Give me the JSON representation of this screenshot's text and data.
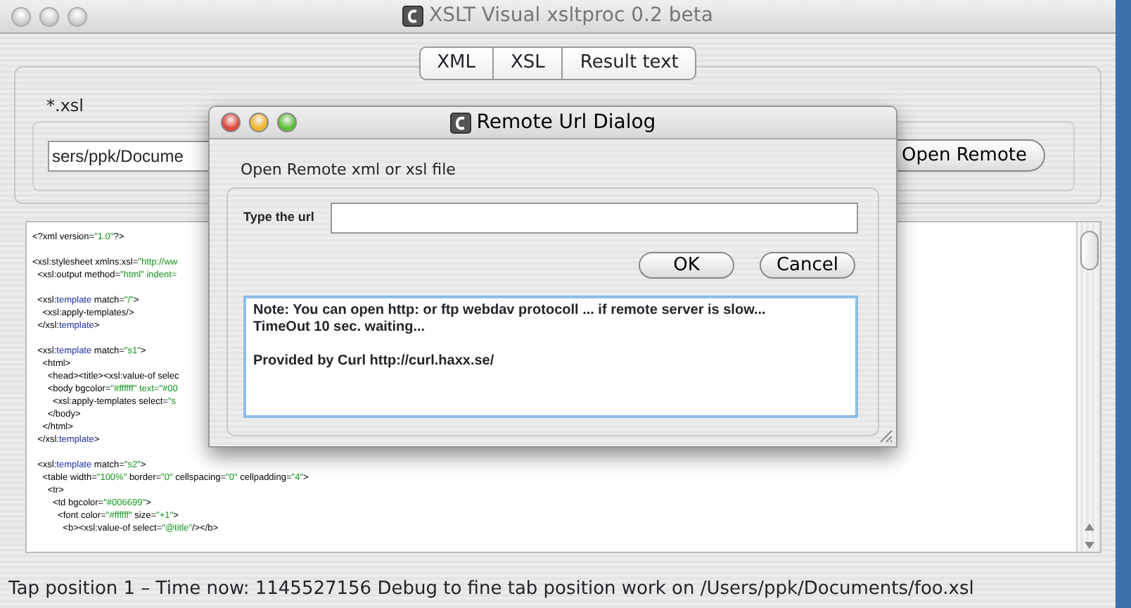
{
  "window": {
    "title": "XSLT Visual xsltproc 0.2 beta",
    "active": false
  },
  "tabs": [
    {
      "label": "XML",
      "selected": false
    },
    {
      "label": "XSL",
      "selected": false
    },
    {
      "label": "Result text",
      "selected": false
    }
  ],
  "file_label": "*.xsl",
  "path_field": {
    "value": "sers/ppk/Docume"
  },
  "open_remote_button": "Open Remote",
  "code_blocks": [
    [
      [
        {
          "kind": "tag",
          "text": "<?xml version="
        },
        {
          "kind": "value",
          "text": "\"1.0\""
        },
        {
          "kind": "tag",
          "text": "?>"
        }
      ]
    ],
    [
      [
        {
          "kind": "tag",
          "text": "<xsl:stylesheet xmlns:xsl="
        },
        {
          "kind": "value",
          "text": "\"http://ww"
        }
      ],
      [
        {
          "kind": "tag",
          "text": "  <xsl:output method="
        },
        {
          "kind": "value",
          "text": "\"html\" indent="
        }
      ]
    ],
    [
      [
        {
          "kind": "tag",
          "text": "  <xsl:"
        },
        {
          "kind": "keyword",
          "text": "template"
        },
        {
          "kind": "tag",
          "text": " match="
        },
        {
          "kind": "value",
          "text": "\"/\""
        },
        {
          "kind": "tag",
          "text": ">"
        }
      ],
      [
        {
          "kind": "tag",
          "text": "    <xsl:apply-templates/>"
        }
      ],
      [
        {
          "kind": "tag",
          "text": "  </xsl:"
        },
        {
          "kind": "keyword",
          "text": "template"
        },
        {
          "kind": "tag",
          "text": ">"
        }
      ]
    ],
    [
      [
        {
          "kind": "tag",
          "text": "  <xsl:"
        },
        {
          "kind": "keyword",
          "text": "template"
        },
        {
          "kind": "tag",
          "text": " match="
        },
        {
          "kind": "value",
          "text": "\"s1\""
        },
        {
          "kind": "tag",
          "text": ">"
        }
      ],
      [
        {
          "kind": "tag",
          "text": "    <html>"
        }
      ],
      [
        {
          "kind": "tag",
          "text": "      <head><title><xsl:value-of selec"
        }
      ],
      [
        {
          "kind": "tag",
          "text": "      <body bgcolor="
        },
        {
          "kind": "value",
          "text": "\"#ffffff\" text=\"#00"
        }
      ],
      [
        {
          "kind": "tag",
          "text": "        <xsl:apply-templates select="
        },
        {
          "kind": "value",
          "text": "\"s"
        }
      ],
      [
        {
          "kind": "tag",
          "text": "      </body>"
        }
      ],
      [
        {
          "kind": "tag",
          "text": "    </html>"
        }
      ],
      [
        {
          "kind": "tag",
          "text": "  </xsl:"
        },
        {
          "kind": "keyword",
          "text": "template"
        },
        {
          "kind": "tag",
          "text": ">"
        }
      ]
    ],
    [
      [
        {
          "kind": "tag",
          "text": "  <xsl:"
        },
        {
          "kind": "keyword",
          "text": "template"
        },
        {
          "kind": "tag",
          "text": " match="
        },
        {
          "kind": "value",
          "text": "\"s2\""
        },
        {
          "kind": "tag",
          "text": ">"
        }
      ],
      [
        {
          "kind": "tag",
          "text": "    <table width="
        },
        {
          "kind": "value",
          "text": "\"100%\""
        },
        {
          "kind": "tag",
          "text": " border="
        },
        {
          "kind": "value",
          "text": "\"0\""
        },
        {
          "kind": "tag",
          "text": " cellspacing="
        },
        {
          "kind": "value",
          "text": "\"0\""
        },
        {
          "kind": "tag",
          "text": " cellpadding="
        },
        {
          "kind": "value",
          "text": "\"4\""
        },
        {
          "kind": "tag",
          "text": ">"
        }
      ],
      [
        {
          "kind": "tag",
          "text": "      <tr>"
        }
      ],
      [
        {
          "kind": "tag",
          "text": "        <td bgcolor="
        },
        {
          "kind": "value",
          "text": "\"#006699\""
        },
        {
          "kind": "tag",
          "text": ">"
        }
      ],
      [
        {
          "kind": "tag",
          "text": "          <font color="
        },
        {
          "kind": "value",
          "text": "\"#ffffff\""
        },
        {
          "kind": "tag",
          "text": " size="
        },
        {
          "kind": "value",
          "text": "\"+1\""
        },
        {
          "kind": "tag",
          "text": ">"
        }
      ],
      [
        {
          "kind": "tag",
          "text": "            <b><xsl:value-of select="
        },
        {
          "kind": "value",
          "text": "\"@title\""
        },
        {
          "kind": "tag",
          "text": "/></b>"
        }
      ]
    ]
  ],
  "status_bar": "Tap position 1 – Time now: 1145527156 Debug to fine tab position work on /Users/ppk/Documents/foo.xsl",
  "dialog": {
    "title": "Remote  Url Dialog",
    "active": true,
    "group_label": "Open Remote xml or xsl file",
    "url_label": "Type the url",
    "buttons": [
      "OK",
      "Cancel"
    ],
    "note_paragraphs": [
      [
        "Note: You can open http: or ftp webdav protocoll ... if remote server is slow...",
        "TimeOut 10 sec.  waiting..."
      ],
      [
        "Provided by Curl  http://curl.haxx.se/"
      ]
    ]
  }
}
